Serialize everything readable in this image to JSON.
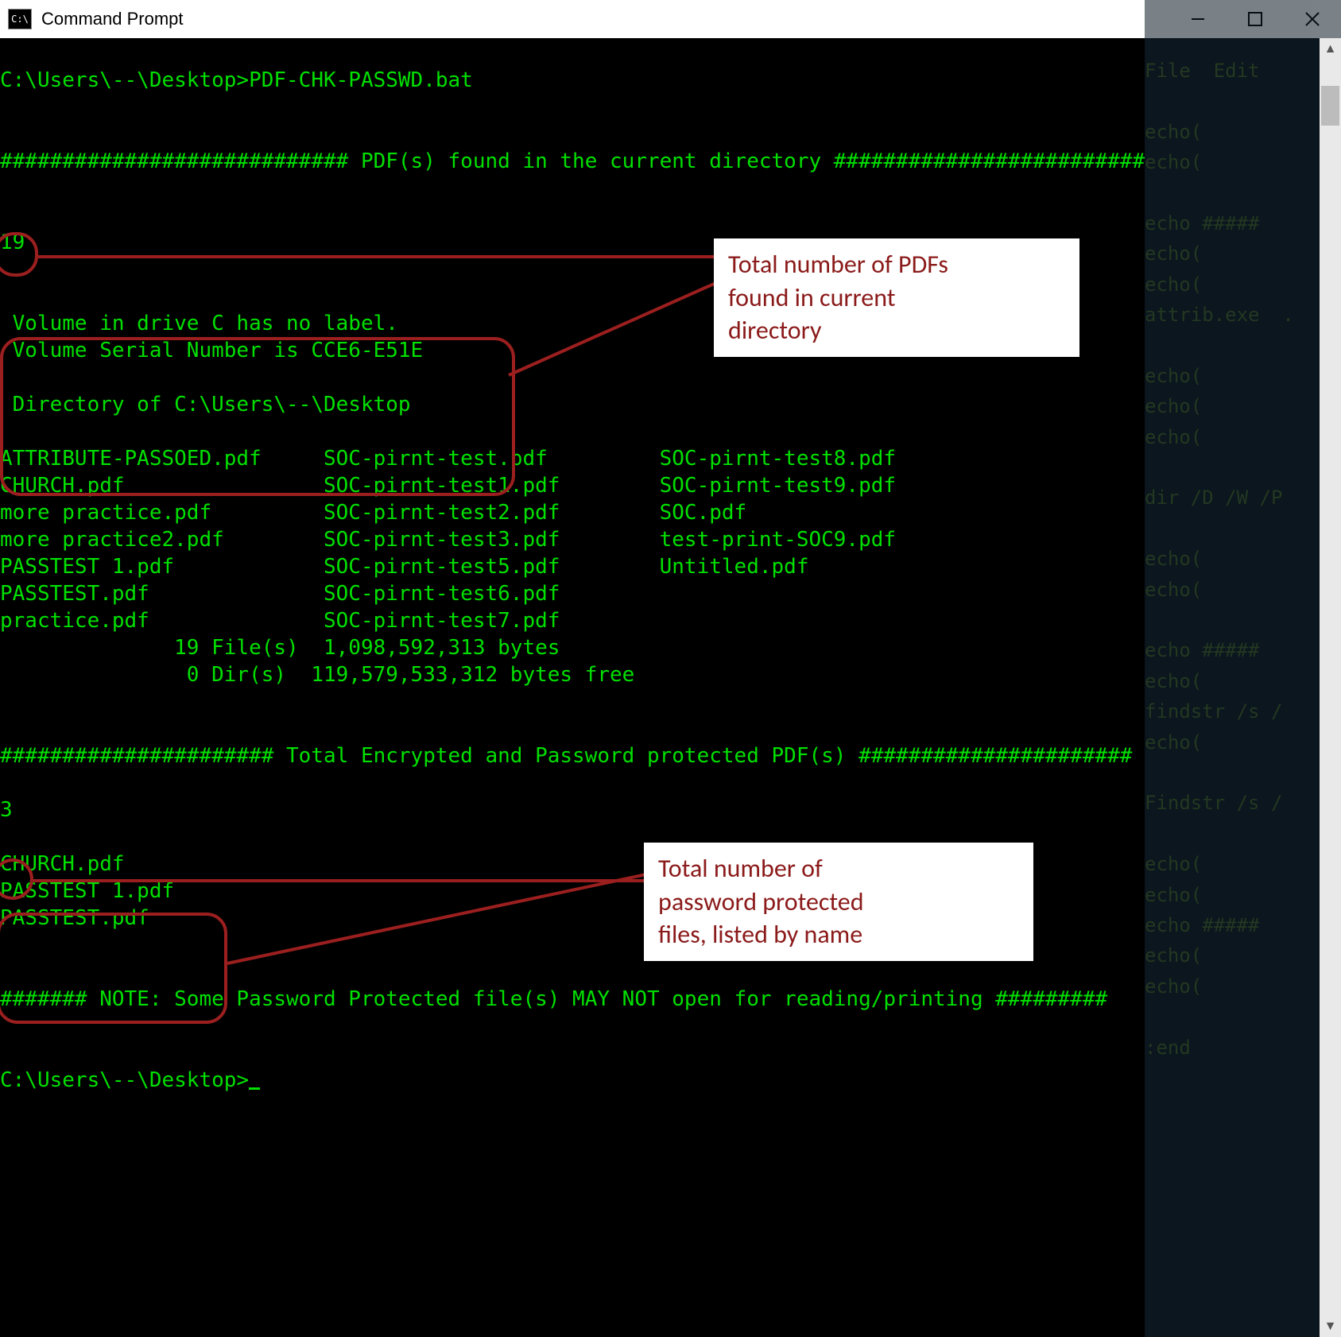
{
  "window": {
    "title": "Command Prompt",
    "icon_label": "C:\\"
  },
  "scrollbar": {
    "thumb_pos": "near-top"
  },
  "bg_editor_lines": [
    "File  Edit",
    "",
    "echo(",
    "echo(",
    "",
    "echo #####",
    "echo(",
    "echo(",
    "attrib.exe  .",
    "",
    "echo(",
    "echo(",
    "echo(",
    "",
    "dir /D /W /P",
    "",
    "echo(",
    "echo(",
    "",
    "echo #####",
    "echo(",
    "findstr /s /",
    "echo(",
    "",
    "Findstr /s /",
    "",
    "echo(",
    "echo(",
    "echo #####",
    "echo(",
    "echo(",
    "",
    ":end"
  ],
  "console": {
    "prompt1": "C:\\Users\\--\\Desktop>PDF-CHK-PASSWD.bat",
    "sep_found": "############################ PDF(s) found in the current directory ###########################",
    "pdf_count": "19",
    "vol1": " Volume in drive C has no label.",
    "vol2": " Volume Serial Number is CCE6-E51E",
    "vol3": " Directory of C:\\Users\\--\\Desktop",
    "file_cols": {
      "c1": [
        "ATTRIBUTE-PASSOED.pdf",
        "CHURCH.pdf",
        "more practice.pdf",
        "more practice2.pdf",
        "PASSTEST 1.pdf",
        "PASSTEST.pdf",
        "practice.pdf"
      ],
      "c2": [
        "SOC-pirnt-test.pdf",
        "SOC-pirnt-test1.pdf",
        "SOC-pirnt-test2.pdf",
        "SOC-pirnt-test3.pdf",
        "SOC-pirnt-test5.pdf",
        "SOC-pirnt-test6.pdf",
        "SOC-pirnt-test7.pdf"
      ],
      "c3": [
        "SOC-pirnt-test8.pdf",
        "SOC-pirnt-test9.pdf",
        "SOC.pdf",
        "test-print-SOC9.pdf",
        "Untitled.pdf"
      ]
    },
    "summary1": "              19 File(s)  1,098,592,313 bytes",
    "summary2": "               0 Dir(s)  119,579,533,312 bytes free",
    "sep_protected": "###################### Total Encrypted and Password protected PDF(s) ######################",
    "protected_count": "3",
    "protected_list": [
      "CHURCH.pdf",
      "PASSTEST 1.pdf",
      "PASSTEST.pdf"
    ],
    "note": "####### NOTE: Some Password Protected file(s) MAY NOT open for reading/printing #########",
    "prompt2": "C:\\Users\\--\\Desktop>"
  },
  "annotations": {
    "a1": "Total number of PDFs\nfound in current\ndirectory",
    "a2": "Total number of\npassword protected\nfiles, listed by name"
  }
}
